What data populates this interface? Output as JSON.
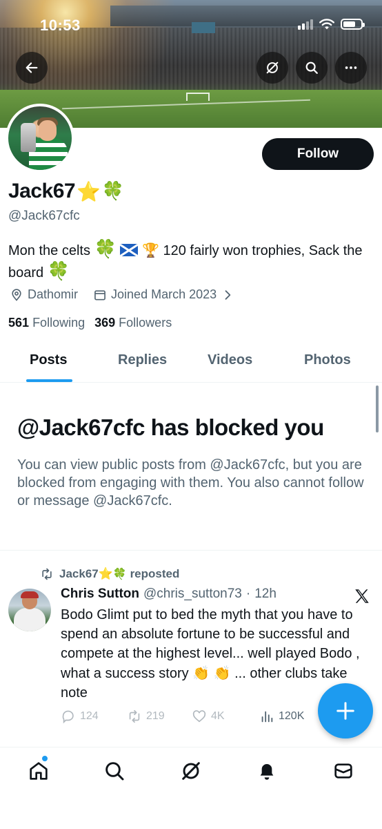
{
  "status_bar": {
    "time": "10:53"
  },
  "profile": {
    "display_name": "Jack67",
    "name_emojis": {
      "star": "⭐",
      "clover": "🍀"
    },
    "handle": "@Jack67cfc",
    "follow_label": "Follow",
    "bio": {
      "part1": "Mon the celts ",
      "clover": "🍀",
      "trophy": "🏆",
      "part2": " 120 fairly won trophies, Sack the board ",
      "clover2": "🍀"
    },
    "location": "Dathomir",
    "joined": "Joined March 2023",
    "following_count": "561",
    "following_label": "Following",
    "followers_count": "369",
    "followers_label": "Followers"
  },
  "tabs": [
    {
      "label": "Posts"
    },
    {
      "label": "Replies"
    },
    {
      "label": "Videos"
    },
    {
      "label": "Photos"
    }
  ],
  "blocked_notice": {
    "title": "@Jack67cfc has blocked you",
    "body": "You can view public posts from @Jack67cfc, but you are blocked from engaging with them. You also cannot follow or message @Jack67cfc."
  },
  "post": {
    "repost_by": "Jack67",
    "repost_suffix": "reposted",
    "author_name": "Chris Sutton",
    "author_handle": "@chris_sutton73",
    "separator": "·",
    "time": "12h",
    "text_part1": "Bodo Glimt put to bed the myth that you have to spend an absolute fortune to be successful and compete at the highest level... well played Bodo , what a success story ",
    "clap": "👏",
    "text_part2": " ... other clubs take note",
    "replies": "124",
    "reposts": "219",
    "likes": "4K",
    "views": "120K"
  },
  "icons": {
    "back": "arrow-left-icon",
    "grok": "grok-icon",
    "search": "search-icon",
    "more": "more-icon",
    "location": "location-pin-icon",
    "calendar": "calendar-icon",
    "home": "home-icon",
    "bell": "bell-icon",
    "mail": "mail-icon"
  },
  "colors": {
    "accent": "#1d9bf0",
    "text": "#0f1419",
    "secondary": "#536471"
  }
}
